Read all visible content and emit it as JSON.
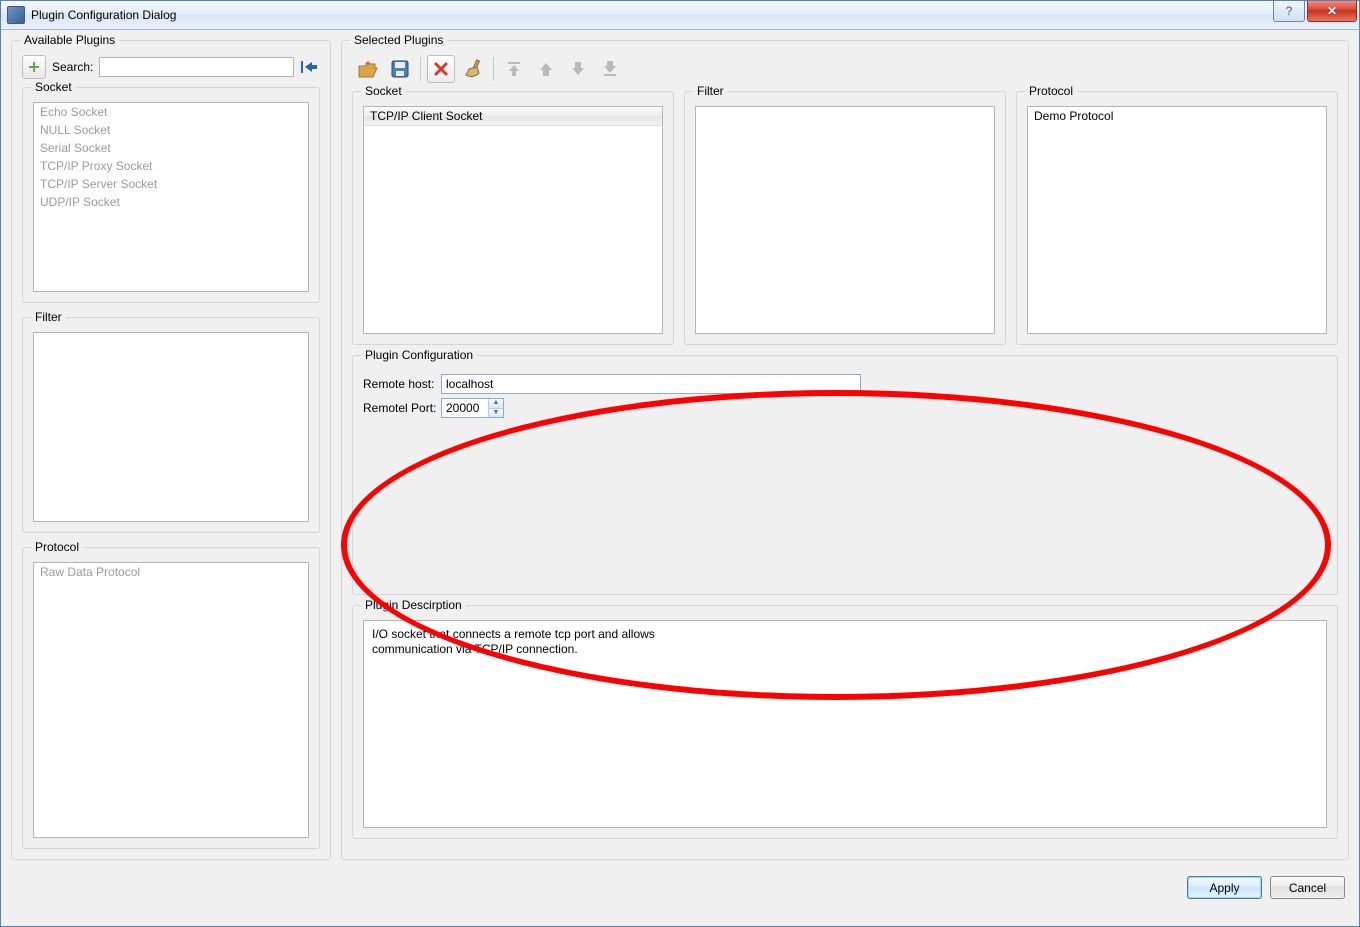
{
  "window": {
    "title": "Plugin Configuration Dialog"
  },
  "left": {
    "group_label": "Available Plugins",
    "search_label": "Search:",
    "search_value": "",
    "socket_label": "Socket",
    "socket_items": [
      "Echo Socket",
      "NULL Socket",
      "Serial Socket",
      "TCP/IP Proxy Socket",
      "TCP/IP Server Socket",
      "UDP/IP Socket"
    ],
    "filter_label": "Filter",
    "protocol_label": "Protocol",
    "protocol_items": [
      "Raw Data Protocol"
    ]
  },
  "right": {
    "group_label": "Selected Plugins",
    "socket_label": "Socket",
    "socket_items": [
      "TCP/IP Client Socket"
    ],
    "filter_label": "Filter",
    "protocol_label": "Protocol",
    "protocol_items": [
      "Demo Protocol"
    ],
    "config_label": "Plugin Configuration",
    "remote_host_label": "Remote host:",
    "remote_host_value": "localhost",
    "remote_port_label": "Remotel Port:",
    "remote_port_value": "20000",
    "desc_label": "Plugin Descirption",
    "desc_line1": "I/O socket that connects a remote tcp port and allows",
    "desc_line2": "communication via TCP/IP connection."
  },
  "buttons": {
    "apply": "Apply",
    "cancel": "Cancel"
  }
}
